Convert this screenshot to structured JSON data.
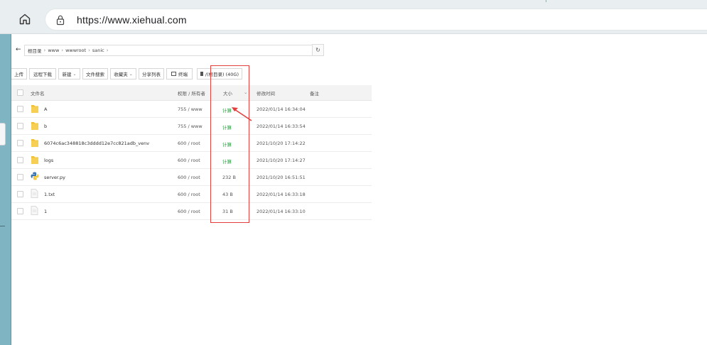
{
  "browser": {
    "url": "https://www.xiehual.com"
  },
  "breadcrumbs": [
    "根目录",
    "www",
    "wwwroot",
    "sanic"
  ],
  "toolbar": {
    "buttons": [
      {
        "label": "上传",
        "dropdown": false
      },
      {
        "label": "远程下载",
        "dropdown": false
      },
      {
        "label": "新建",
        "dropdown": true
      },
      {
        "label": "文件搜索",
        "dropdown": false
      },
      {
        "label": "收藏夹",
        "dropdown": true
      },
      {
        "label": "分享列表",
        "dropdown": false
      },
      {
        "label": "终端",
        "dropdown": false
      },
      {
        "label": "/(根目录) (40G)",
        "dropdown": false
      }
    ]
  },
  "table": {
    "headers": {
      "name": "文件名",
      "perm": "权限 / 所有者",
      "size": "大小",
      "mtime": "修改时间",
      "note": "备注"
    },
    "rows": [
      {
        "name": "A",
        "type": "folder",
        "perm": "755 / www",
        "size": "计算",
        "mtime": "2022/01/14 16:34:04"
      },
      {
        "name": "b",
        "type": "folder",
        "perm": "755 / www",
        "size": "计算",
        "mtime": "2022/01/14 16:33:54"
      },
      {
        "name": "6074c6ac348818c3dddd12e7cc821adb_venv",
        "type": "folder",
        "perm": "600 / root",
        "size": "计算",
        "mtime": "2021/10/20 17:14:22"
      },
      {
        "name": "logs",
        "type": "folder",
        "perm": "600 / root",
        "size": "计算",
        "mtime": "2021/10/20 17:14:27"
      },
      {
        "name": "server.py",
        "type": "python",
        "perm": "600 / root",
        "size": "232 B",
        "mtime": "2021/10/20 16:51:51"
      },
      {
        "name": "1.txt",
        "type": "file",
        "perm": "600 / root",
        "size": "43 B",
        "mtime": "2022/01/14 16:33:18"
      },
      {
        "name": "1",
        "type": "file",
        "perm": "600 / root",
        "size": "31 B",
        "mtime": "2022/01/14 16:33:10"
      }
    ]
  },
  "colors": {
    "accent_green": "#20a53a",
    "highlight_red": "#e2403d",
    "folder_yellow": "#f2c037"
  },
  "icons": {
    "home": "home-icon",
    "lock": "lock-icon",
    "back": "back-arrow-icon",
    "refresh": "refresh-icon",
    "folder": "folder-icon",
    "python": "python-file-icon",
    "file": "file-icon"
  }
}
